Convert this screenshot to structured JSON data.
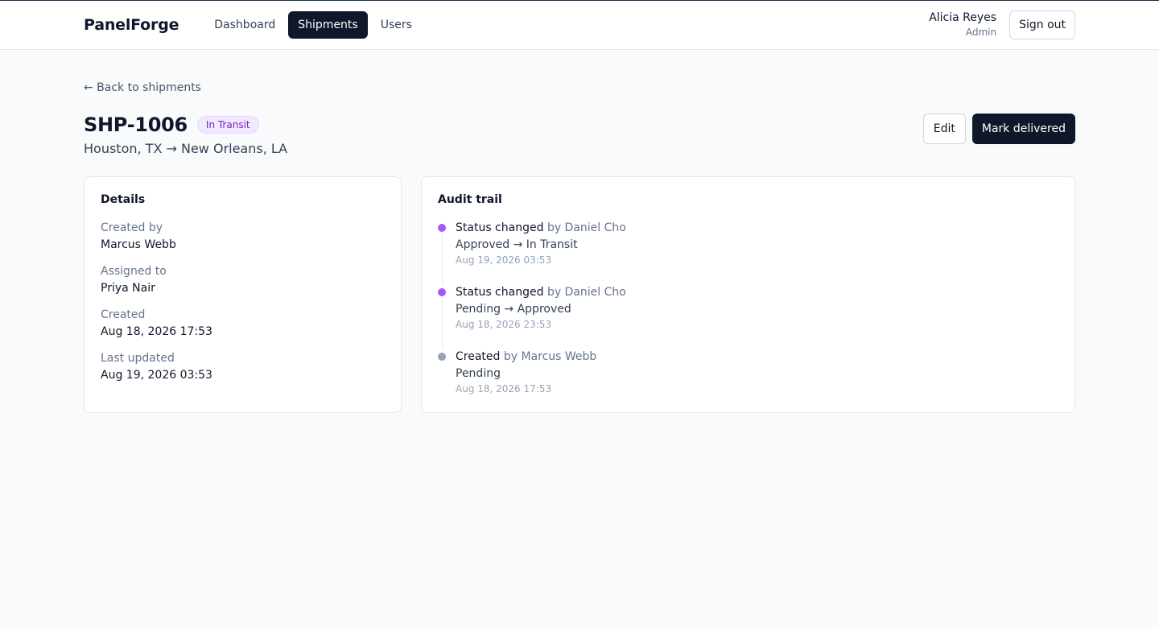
{
  "app": {
    "brand": "PanelForge"
  },
  "nav": {
    "items": [
      {
        "label": "Dashboard",
        "active": false
      },
      {
        "label": "Shipments",
        "active": true
      },
      {
        "label": "Users",
        "active": false
      }
    ]
  },
  "user": {
    "name": "Alicia Reyes",
    "role": "Admin",
    "signout_label": "Sign out"
  },
  "page": {
    "back_label": "← Back to shipments",
    "shipment_id": "SHP-1006",
    "status": "In Transit",
    "status_color": "#7e22ce",
    "route": "Houston, TX → New Orleans, LA",
    "edit_label": "Edit",
    "mark_delivered_label": "Mark delivered"
  },
  "details": {
    "title": "Details",
    "fields": [
      {
        "label": "Created by",
        "value": "Marcus Webb"
      },
      {
        "label": "Assigned to",
        "value": "Priya Nair"
      },
      {
        "label": "Created",
        "value": "Aug 18, 2026 17:53"
      },
      {
        "label": "Last updated",
        "value": "Aug 19, 2026 03:53"
      }
    ]
  },
  "audit": {
    "title": "Audit trail",
    "entries": [
      {
        "action": "Status changed",
        "by": "by Daniel Cho",
        "change": "Approved → In Transit",
        "time": "Aug 19, 2026 03:53",
        "dot_color": "#a855f7"
      },
      {
        "action": "Status changed",
        "by": "by Daniel Cho",
        "change": "Pending → Approved",
        "time": "Aug 18, 2026 23:53",
        "dot_color": "#a855f7"
      },
      {
        "action": "Created",
        "by": "by Marcus Webb",
        "change": "Pending",
        "time": "Aug 18, 2026 17:53",
        "dot_color": "#94a3b8"
      }
    ]
  }
}
